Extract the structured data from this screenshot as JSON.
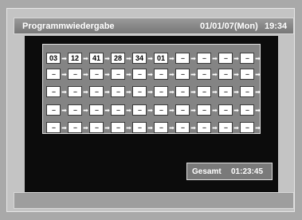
{
  "header": {
    "title": "Programmwiedergabe",
    "date": "01/01/07(Mon)",
    "time": "19:34"
  },
  "program": {
    "rows": [
      [
        "03",
        "12",
        "41",
        "28",
        "34",
        "01",
        "--",
        "--",
        "--",
        "--"
      ],
      [
        "--",
        "--",
        "--",
        "--",
        "--",
        "--",
        "--",
        "--",
        "--",
        "--"
      ],
      [
        "--",
        "--",
        "--",
        "--",
        "--",
        "--",
        "--",
        "--",
        "--",
        "--"
      ],
      [
        "--",
        "--",
        "--",
        "--",
        "--",
        "--",
        "--",
        "--",
        "--",
        "--"
      ],
      [
        "--",
        "--",
        "--",
        "--",
        "--",
        "--",
        "--",
        "--",
        "--",
        "--"
      ]
    ],
    "arrow_glyph": "➡"
  },
  "total": {
    "label": "Gesamt",
    "value": "01:23:45"
  }
}
